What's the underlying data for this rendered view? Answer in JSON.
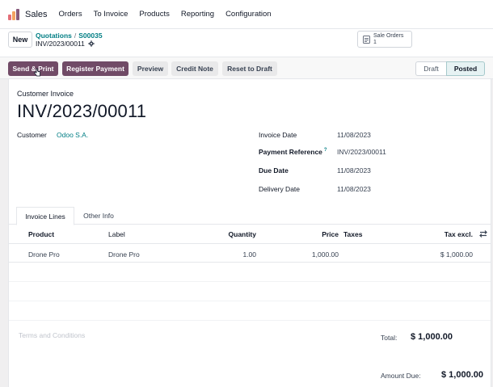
{
  "app": {
    "name": "Sales"
  },
  "menu": [
    "Orders",
    "To Invoice",
    "Products",
    "Reporting",
    "Configuration"
  ],
  "control": {
    "new_label": "New",
    "breadcrumb": [
      "Quotations",
      "S00035"
    ],
    "current_record": "INV/2023/00011",
    "smart_button": {
      "label": "Sale Orders",
      "count": "1"
    }
  },
  "actions": {
    "send_print": "Send & Print",
    "register_payment": "Register Payment",
    "preview": "Preview",
    "credit_note": "Credit Note",
    "reset_to_draft": "Reset to Draft"
  },
  "status": {
    "draft": "Draft",
    "posted": "Posted",
    "current": "Posted"
  },
  "invoice": {
    "type_label": "Customer Invoice",
    "number": "INV/2023/00011",
    "customer_label": "Customer",
    "customer": "Odoo S.A.",
    "invoice_date_label": "Invoice Date",
    "invoice_date": "11/08/2023",
    "payment_ref_label": "Payment Reference",
    "payment_ref_help": "?",
    "payment_ref": "INV/2023/00011",
    "due_date_label": "Due Date",
    "due_date": "11/08/2023",
    "delivery_date_label": "Delivery Date",
    "delivery_date": "11/08/2023"
  },
  "tabs": [
    "Invoice Lines",
    "Other Info"
  ],
  "lines": {
    "headers": {
      "product": "Product",
      "label": "Label",
      "quantity": "Quantity",
      "price": "Price",
      "taxes": "Taxes",
      "tax_excl": "Tax excl."
    },
    "rows": [
      {
        "product": "Drone Pro",
        "label": "Drone Pro",
        "quantity": "1.00",
        "price": "1,000.00",
        "taxes": "",
        "tax_excl": "$ 1,000.00"
      }
    ]
  },
  "footer": {
    "terms_placeholder": "Terms and Conditions",
    "total_label": "Total:",
    "total": "$ 1,000.00",
    "amount_due_label": "Amount Due:",
    "amount_due": "$ 1,000.00"
  },
  "colors": {
    "primary": "#714b67",
    "link": "#017e84"
  }
}
